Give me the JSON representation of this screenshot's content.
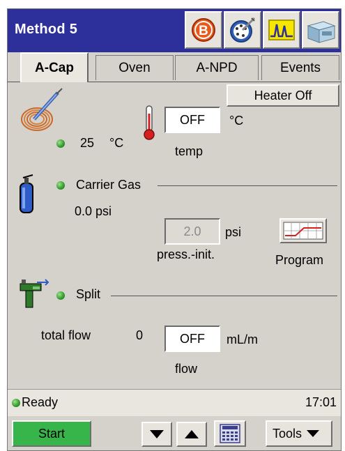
{
  "window": {
    "title": "Method 5"
  },
  "toolbar_icons": [
    "b-badge-icon",
    "dial-tool-icon",
    "chromatogram-icon",
    "instrument-icon"
  ],
  "toolbar_b_letter": "B",
  "tabs": [
    {
      "label": "A-Cap",
      "active": true
    },
    {
      "label": "Oven",
      "active": false
    },
    {
      "label": "A-NPD",
      "active": false
    },
    {
      "label": "Events",
      "active": false
    }
  ],
  "heater": {
    "button_label": "Heater Off",
    "actual_value": "25",
    "unit": "°C",
    "setpoint_value": "OFF",
    "setpoint_unit": "°C",
    "setpoint_caption": "temp"
  },
  "carrier": {
    "label": "Carrier Gas",
    "actual_pressure": "0.0 psi",
    "init_pressure_value": "2.0",
    "init_pressure_unit": "psi",
    "init_caption": "press.-init.",
    "program_label": "Program"
  },
  "split": {
    "label": "Split",
    "total_flow_label": "total flow",
    "total_flow_value": "0",
    "flow_setpoint": "OFF",
    "flow_unit": "mL/m",
    "flow_caption": "flow"
  },
  "status": {
    "text": "Ready",
    "time": "17:01"
  },
  "bottom": {
    "start_label": "Start",
    "tools_label": "Tools"
  },
  "colors": {
    "title_bar": "#2d2f9b",
    "panel": "#d4d2cb",
    "start_button": "#38b54a",
    "ready_indicator": "#3aa52f"
  }
}
